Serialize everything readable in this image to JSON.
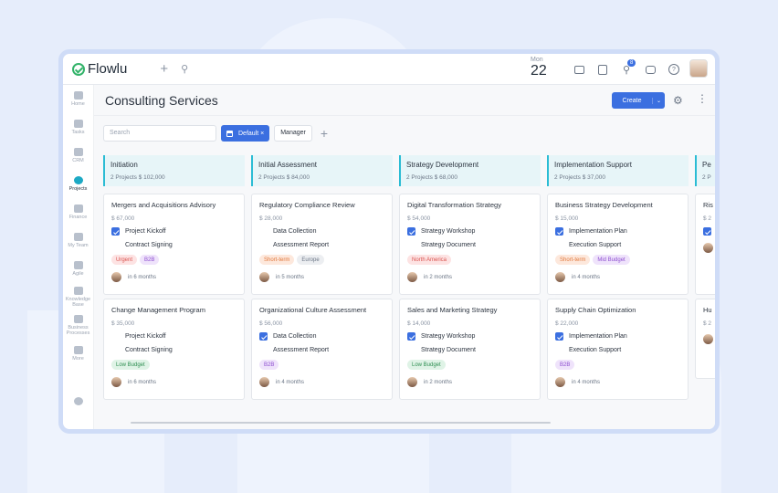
{
  "app": {
    "name": "Flowlu"
  },
  "date": {
    "month": "Mon",
    "day": "22"
  },
  "notifications_count": "8",
  "sidebar": {
    "items": [
      {
        "label": "Home",
        "icon": "home-icon",
        "active": false
      },
      {
        "label": "Tasks",
        "icon": "tasks-icon",
        "active": false
      },
      {
        "label": "CRM",
        "icon": "crm-icon",
        "active": false
      },
      {
        "label": "Projects",
        "icon": "projects-icon",
        "active": true
      },
      {
        "label": "Finance",
        "icon": "finance-icon",
        "active": false
      },
      {
        "label": "My Team",
        "icon": "team-icon",
        "active": false
      },
      {
        "label": "Agile",
        "icon": "agile-icon",
        "active": false
      },
      {
        "label": "Knowledge Base",
        "icon": "knowledge-icon",
        "active": false
      },
      {
        "label": "Business Processes",
        "icon": "processes-icon",
        "active": false
      },
      {
        "label": "More",
        "icon": "more-icon",
        "active": false
      }
    ]
  },
  "page": {
    "title": "Consulting Services",
    "create_label": "Create"
  },
  "filters": {
    "search_placeholder": "Search",
    "default_label": "Default ×",
    "manager_label": "Manager"
  },
  "accent": "#3b6fe0",
  "columns": [
    {
      "name": "Initiation",
      "summary": "2 Projects  $ 102,000",
      "cards": [
        {
          "name": "Mergers and Acquisitions Advisory",
          "price": "$ 67,000",
          "tasks": [
            {
              "label": "Project Kickoff",
              "done": true
            },
            {
              "label": "Contract Signing",
              "done": false
            }
          ],
          "tags": [
            {
              "label": "Urgent",
              "bg": "#fde3e3",
              "fg": "#d9534f"
            },
            {
              "label": "B2B",
              "bg": "#efe3fb",
              "fg": "#8e4fd0"
            }
          ],
          "due": "in 6 months"
        },
        {
          "name": "Change Management Program",
          "price": "$ 35,000",
          "tasks": [
            {
              "label": "Project Kickoff",
              "done": false
            },
            {
              "label": "Contract Signing",
              "done": false
            }
          ],
          "tags": [
            {
              "label": "Low Budget",
              "bg": "#dff3e6",
              "fg": "#2f8f52"
            }
          ],
          "due": "in 6 months"
        }
      ]
    },
    {
      "name": "Initial Assessment",
      "summary": "2 Projects  $ 84,000",
      "cards": [
        {
          "name": "Regulatory Compliance Review",
          "price": "$ 28,000",
          "tasks": [
            {
              "label": "Data Collection",
              "done": false
            },
            {
              "label": "Assessment Report",
              "done": false
            }
          ],
          "tags": [
            {
              "label": "Short-term",
              "bg": "#fde8dc",
              "fg": "#e0773c"
            },
            {
              "label": "Europe",
              "bg": "#eceef1",
              "fg": "#6b7686"
            }
          ],
          "due": "in 5 months"
        },
        {
          "name": "Organizational Culture Assessment",
          "price": "$ 56,000",
          "tasks": [
            {
              "label": "Data Collection",
              "done": true
            },
            {
              "label": "Assessment Report",
              "done": false
            }
          ],
          "tags": [
            {
              "label": "B2B",
              "bg": "#efe3fb",
              "fg": "#8e4fd0"
            }
          ],
          "due": "in 4 months"
        }
      ]
    },
    {
      "name": "Strategy Development",
      "summary": "2 Projects  $ 68,000",
      "cards": [
        {
          "name": "Digital Transformation Strategy",
          "price": "$ 54,000",
          "tasks": [
            {
              "label": "Strategy Workshop",
              "done": true
            },
            {
              "label": "Strategy Document",
              "done": false
            }
          ],
          "tags": [
            {
              "label": "North America",
              "bg": "#fde3e3",
              "fg": "#d9534f"
            }
          ],
          "due": "in 2 months"
        },
        {
          "name": "Sales and Marketing Strategy",
          "price": "$ 14,000",
          "tasks": [
            {
              "label": "Strategy Workshop",
              "done": true
            },
            {
              "label": "Strategy Document",
              "done": false
            }
          ],
          "tags": [
            {
              "label": "Low Budget",
              "bg": "#dff3e6",
              "fg": "#2f8f52"
            }
          ],
          "due": "in 2 months"
        }
      ]
    },
    {
      "name": "Implementation Support",
      "summary": "2 Projects  $ 37,000",
      "cards": [
        {
          "name": "Business Strategy Development",
          "price": "$ 15,000",
          "tasks": [
            {
              "label": "Implementation Plan",
              "done": true
            },
            {
              "label": "Execution Support",
              "done": false
            }
          ],
          "tags": [
            {
              "label": "Short-term",
              "bg": "#fde8dc",
              "fg": "#e0773c"
            },
            {
              "label": "Mid Budget",
              "bg": "#efe3fb",
              "fg": "#8e4fd0"
            }
          ],
          "due": "in 4 months"
        },
        {
          "name": "Supply Chain Optimization",
          "price": "$ 22,000",
          "tasks": [
            {
              "label": "Implementation Plan",
              "done": true
            },
            {
              "label": "Execution Support",
              "done": false
            }
          ],
          "tags": [
            {
              "label": "B2B",
              "bg": "#efe3fb",
              "fg": "#8e4fd0"
            }
          ],
          "due": "in 4 months"
        }
      ]
    },
    {
      "name": "Pe",
      "summary": "2 P",
      "cards": [
        {
          "name": "Ris",
          "price": "$ 2",
          "tasks": [
            {
              "label": "",
              "done": true
            }
          ],
          "tags": [],
          "due": ""
        },
        {
          "name": "Hu",
          "price": "$ 2",
          "tasks": [],
          "tags": [],
          "due": ""
        }
      ]
    }
  ]
}
